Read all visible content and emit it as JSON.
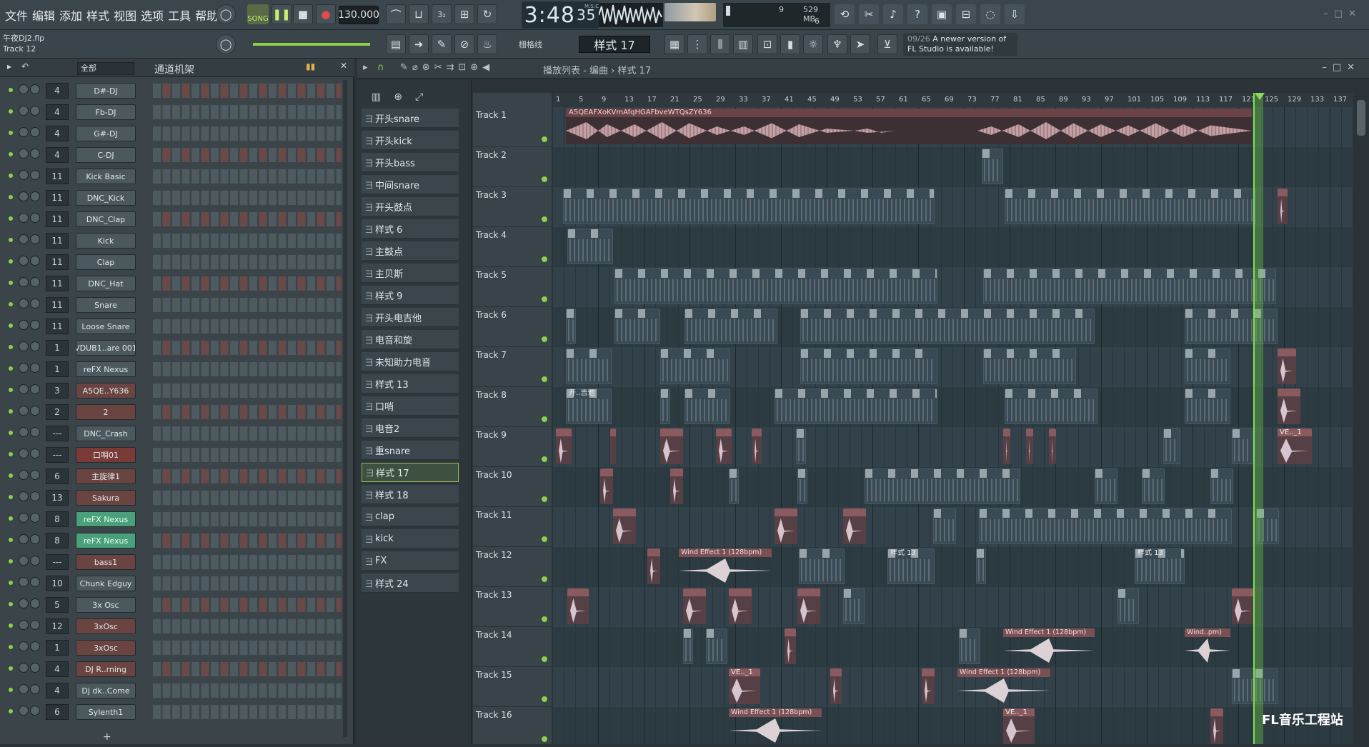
{
  "menu": [
    "文件",
    "编辑",
    "添加",
    "样式",
    "视图",
    "选项",
    "工具",
    "帮助"
  ],
  "transport": {
    "song_label": "SONG",
    "tempo": "130.000",
    "time_main": "3:48",
    "time_sub": "35",
    "time_unit": "M:S:CS",
    "cpu_line1": "9",
    "cpu_line2": "6",
    "memory": "529 MB"
  },
  "project": {
    "file": "午夜DJ2.flp",
    "track": "Track 12"
  },
  "snap_label": "栅格线",
  "current_pattern": "样式 17",
  "news": {
    "date": "09/26",
    "text": "A newer version of FL Studio is available!"
  },
  "rack": {
    "filter": "全部",
    "title": "通道机架",
    "channels": [
      {
        "num": "4",
        "name": "D#-DJ",
        "style": ""
      },
      {
        "num": "4",
        "name": "Fb-DJ",
        "style": ""
      },
      {
        "num": "4",
        "name": "G#-DJ",
        "style": ""
      },
      {
        "num": "4",
        "name": "C-DJ",
        "style": ""
      },
      {
        "num": "11",
        "name": "Kick Basic",
        "style": ""
      },
      {
        "num": "11",
        "name": "DNC_Kick",
        "style": ""
      },
      {
        "num": "11",
        "name": "DNC_Clap",
        "style": ""
      },
      {
        "num": "11",
        "name": "Kick",
        "style": ""
      },
      {
        "num": "11",
        "name": "Clap",
        "style": ""
      },
      {
        "num": "11",
        "name": "DNC_Hat",
        "style": ""
      },
      {
        "num": "11",
        "name": "Snare",
        "style": ""
      },
      {
        "num": "11",
        "name": "Loose Snare",
        "style": ""
      },
      {
        "num": "1",
        "name": "VDUB1..are 001",
        "style": ""
      },
      {
        "num": "1",
        "name": "reFX Nexus",
        "style": ""
      },
      {
        "num": "3",
        "name": "A5QE..Y636",
        "style": "brown"
      },
      {
        "num": "2",
        "name": "2",
        "style": "brown"
      },
      {
        "num": "---",
        "name": "DNC_Crash",
        "style": ""
      },
      {
        "num": "---",
        "name": "口哨01",
        "style": "red"
      },
      {
        "num": "6",
        "name": "主旋律1",
        "style": "brown"
      },
      {
        "num": "13",
        "name": "Sakura",
        "style": "brown"
      },
      {
        "num": "8",
        "name": "reFX Nexus",
        "style": "green"
      },
      {
        "num": "8",
        "name": "reFX Nexus",
        "style": "green"
      },
      {
        "num": "---",
        "name": "bass1",
        "style": "brown"
      },
      {
        "num": "10",
        "name": "Chunk Edguy",
        "style": ""
      },
      {
        "num": "5",
        "name": "3x Osc",
        "style": ""
      },
      {
        "num": "12",
        "name": "3xOsc",
        "style": "brown"
      },
      {
        "num": "1",
        "name": "3xOsc",
        "style": "brown"
      },
      {
        "num": "4",
        "name": "DJ R..rning",
        "style": "brown"
      },
      {
        "num": "4",
        "name": "Dj dk..Come",
        "style": ""
      },
      {
        "num": "6",
        "name": "Sylenth1",
        "style": ""
      }
    ]
  },
  "playlist": {
    "breadcrumb": "播放列表 - 编曲 › 样式 17",
    "patterns": [
      "开头snare",
      "开头kick",
      "开头bass",
      "中间snare",
      "开头鼓点",
      "样式 6",
      "主鼓点",
      "主贝斯",
      "样式 9",
      "开头电吉他",
      "电音和旋",
      "未知助力电音",
      "样式 13",
      "口哨",
      "电音2",
      "重snare",
      "样式 17",
      "样式 18",
      "clap",
      "kick",
      "FX",
      "样式 24"
    ],
    "selected_pattern": "样式 17",
    "tracks": [
      "Track 1",
      "Track 2",
      "Track 3",
      "Track 4",
      "Track 5",
      "Track 6",
      "Track 7",
      "Track 8",
      "Track 9",
      "Track 10",
      "Track 11",
      "Track 12",
      "Track 13",
      "Track 14",
      "Track 15",
      "Track 16"
    ],
    "ruler": [
      "1",
      "5",
      "9",
      "13",
      "17",
      "21",
      "25",
      "29",
      "33",
      "37",
      "41",
      "45",
      "49",
      "53",
      "57",
      "61",
      "65",
      "69",
      "73",
      "77",
      "81",
      "85",
      "89",
      "93",
      "97",
      "101",
      "105",
      "109",
      "113",
      "117",
      "121",
      "125",
      "129",
      "133",
      "137"
    ],
    "clip_labels": {
      "audio_title": "A5QEAFXoKVmAfqHGAFbveWTQsZY636",
      "wind": "Wind Effect 1 (128bpm)",
      "style13": "样式 13",
      "guitar": "开..吉他",
      "ve1": "VE.._1",
      "wind_short": "Wind..pm)"
    }
  },
  "watermark": "FL音乐工程站"
}
